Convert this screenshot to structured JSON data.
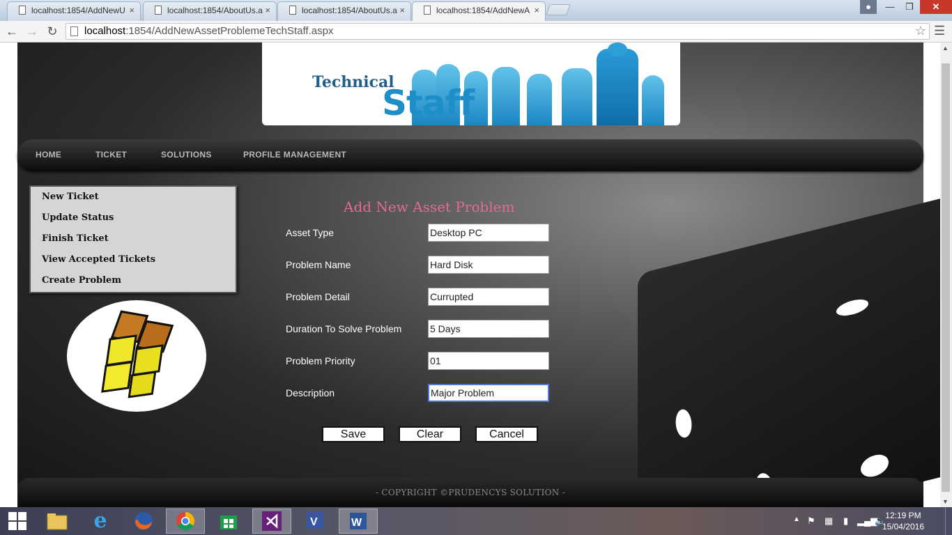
{
  "browser": {
    "tabs": [
      {
        "title": "localhost:1854/AddNewU",
        "active": false
      },
      {
        "title": "localhost:1854/AboutUs.a",
        "active": false
      },
      {
        "title": "localhost:1854/AboutUs.a",
        "active": false
      },
      {
        "title": "localhost:1854/AddNewA",
        "active": true
      }
    ],
    "url_host": "localhost",
    "url_rest": ":1854/AddNewAssetProblemeTechStaff.aspx"
  },
  "banner": {
    "line1": "Technical",
    "line2": "Staff"
  },
  "nav": {
    "items": [
      "HOME",
      "TICKET",
      "SOLUTIONS",
      "PROFILE MANAGEMENT"
    ]
  },
  "side_menu": {
    "items": [
      "New Ticket",
      "Update Status",
      "Finish Ticket",
      "View Accepted Tickets",
      "Create Problem"
    ]
  },
  "form": {
    "title": "Add New Asset Problem",
    "fields": [
      {
        "label": "Asset Type",
        "value": "Desktop PC"
      },
      {
        "label": "Problem Name",
        "value": "Hard Disk"
      },
      {
        "label": "Problem Detail",
        "value": "Currupted"
      },
      {
        "label": "Duration To Solve Problem",
        "value": "5 Days"
      },
      {
        "label": "Problem Priority",
        "value": "01"
      },
      {
        "label": "Description",
        "value": "Major Problem"
      }
    ],
    "buttons": {
      "save": "Save",
      "clear": "Clear",
      "cancel": "Cancel"
    }
  },
  "footer": {
    "text": "- COPYRIGHT ©PRUDENCYS SOLUTION -"
  },
  "taskbar": {
    "clock_time": "12:19 PM",
    "clock_date": "15/04/2016",
    "apps": [
      "start-icon",
      "file-explorer-icon",
      "internet-explorer-icon",
      "firefox-icon",
      "chrome-icon",
      "store-icon",
      "visual-studio-icon",
      "visio-icon",
      "word-icon"
    ]
  },
  "colors": {
    "form_title": "#e46a8f",
    "nav_text": "#b8b8b8",
    "side_menu_bg": "#d5d5d8",
    "close_button": "#c7372a"
  }
}
